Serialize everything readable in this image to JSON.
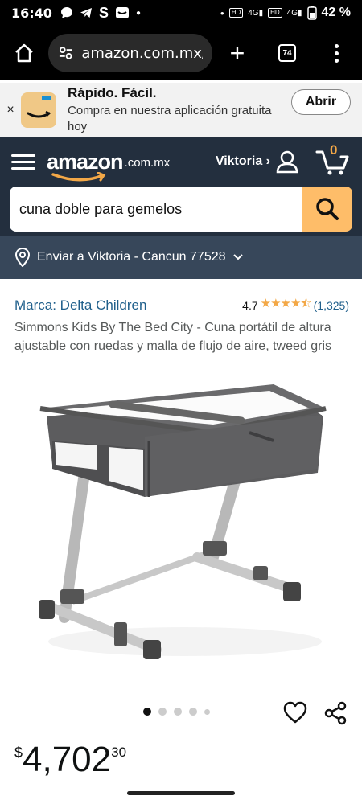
{
  "status_bar": {
    "time": "16:40",
    "left_icons": [
      "chat-icon",
      "telegram-icon",
      "s-icon",
      "mail-icon"
    ],
    "right_badges": [
      "HD",
      "4G",
      "HD",
      "4G"
    ],
    "battery": "42 %"
  },
  "browser": {
    "url": "amazon.com.mx/",
    "tabs_count": "74"
  },
  "app_banner": {
    "title": "Rápido. Fácil.",
    "subtitle": "Compra en nuestra aplicación gratuita hoy",
    "open_label": "Abrir",
    "close_glyph": "×"
  },
  "header": {
    "logo": "amazon",
    "domain": ".com.mx",
    "user_label": "Viktoria ›",
    "cart_count": "0"
  },
  "search": {
    "query": "cuna doble para gemelos"
  },
  "delivery": {
    "text": "Enviar a Viktoria - Cancun 77528"
  },
  "product": {
    "brand": "Marca: Delta Children",
    "rating": "4.7",
    "stars": "★★★★⯪",
    "reviews": "(1,325)",
    "title": "Simmons Kids By The Bed City - Cuna portátil de altura ajustable con ruedas y malla de flujo de aire, tweed gris"
  },
  "carousel": {
    "total": 5,
    "active": 0
  },
  "price": {
    "symbol": "$",
    "main": "4,702",
    "cents": "30"
  },
  "colors": {
    "header_bg": "#232f3e",
    "delivery_bg": "#37475a",
    "search_btn": "#febd69",
    "link": "#1f5f8b",
    "star": "#f3a847"
  }
}
